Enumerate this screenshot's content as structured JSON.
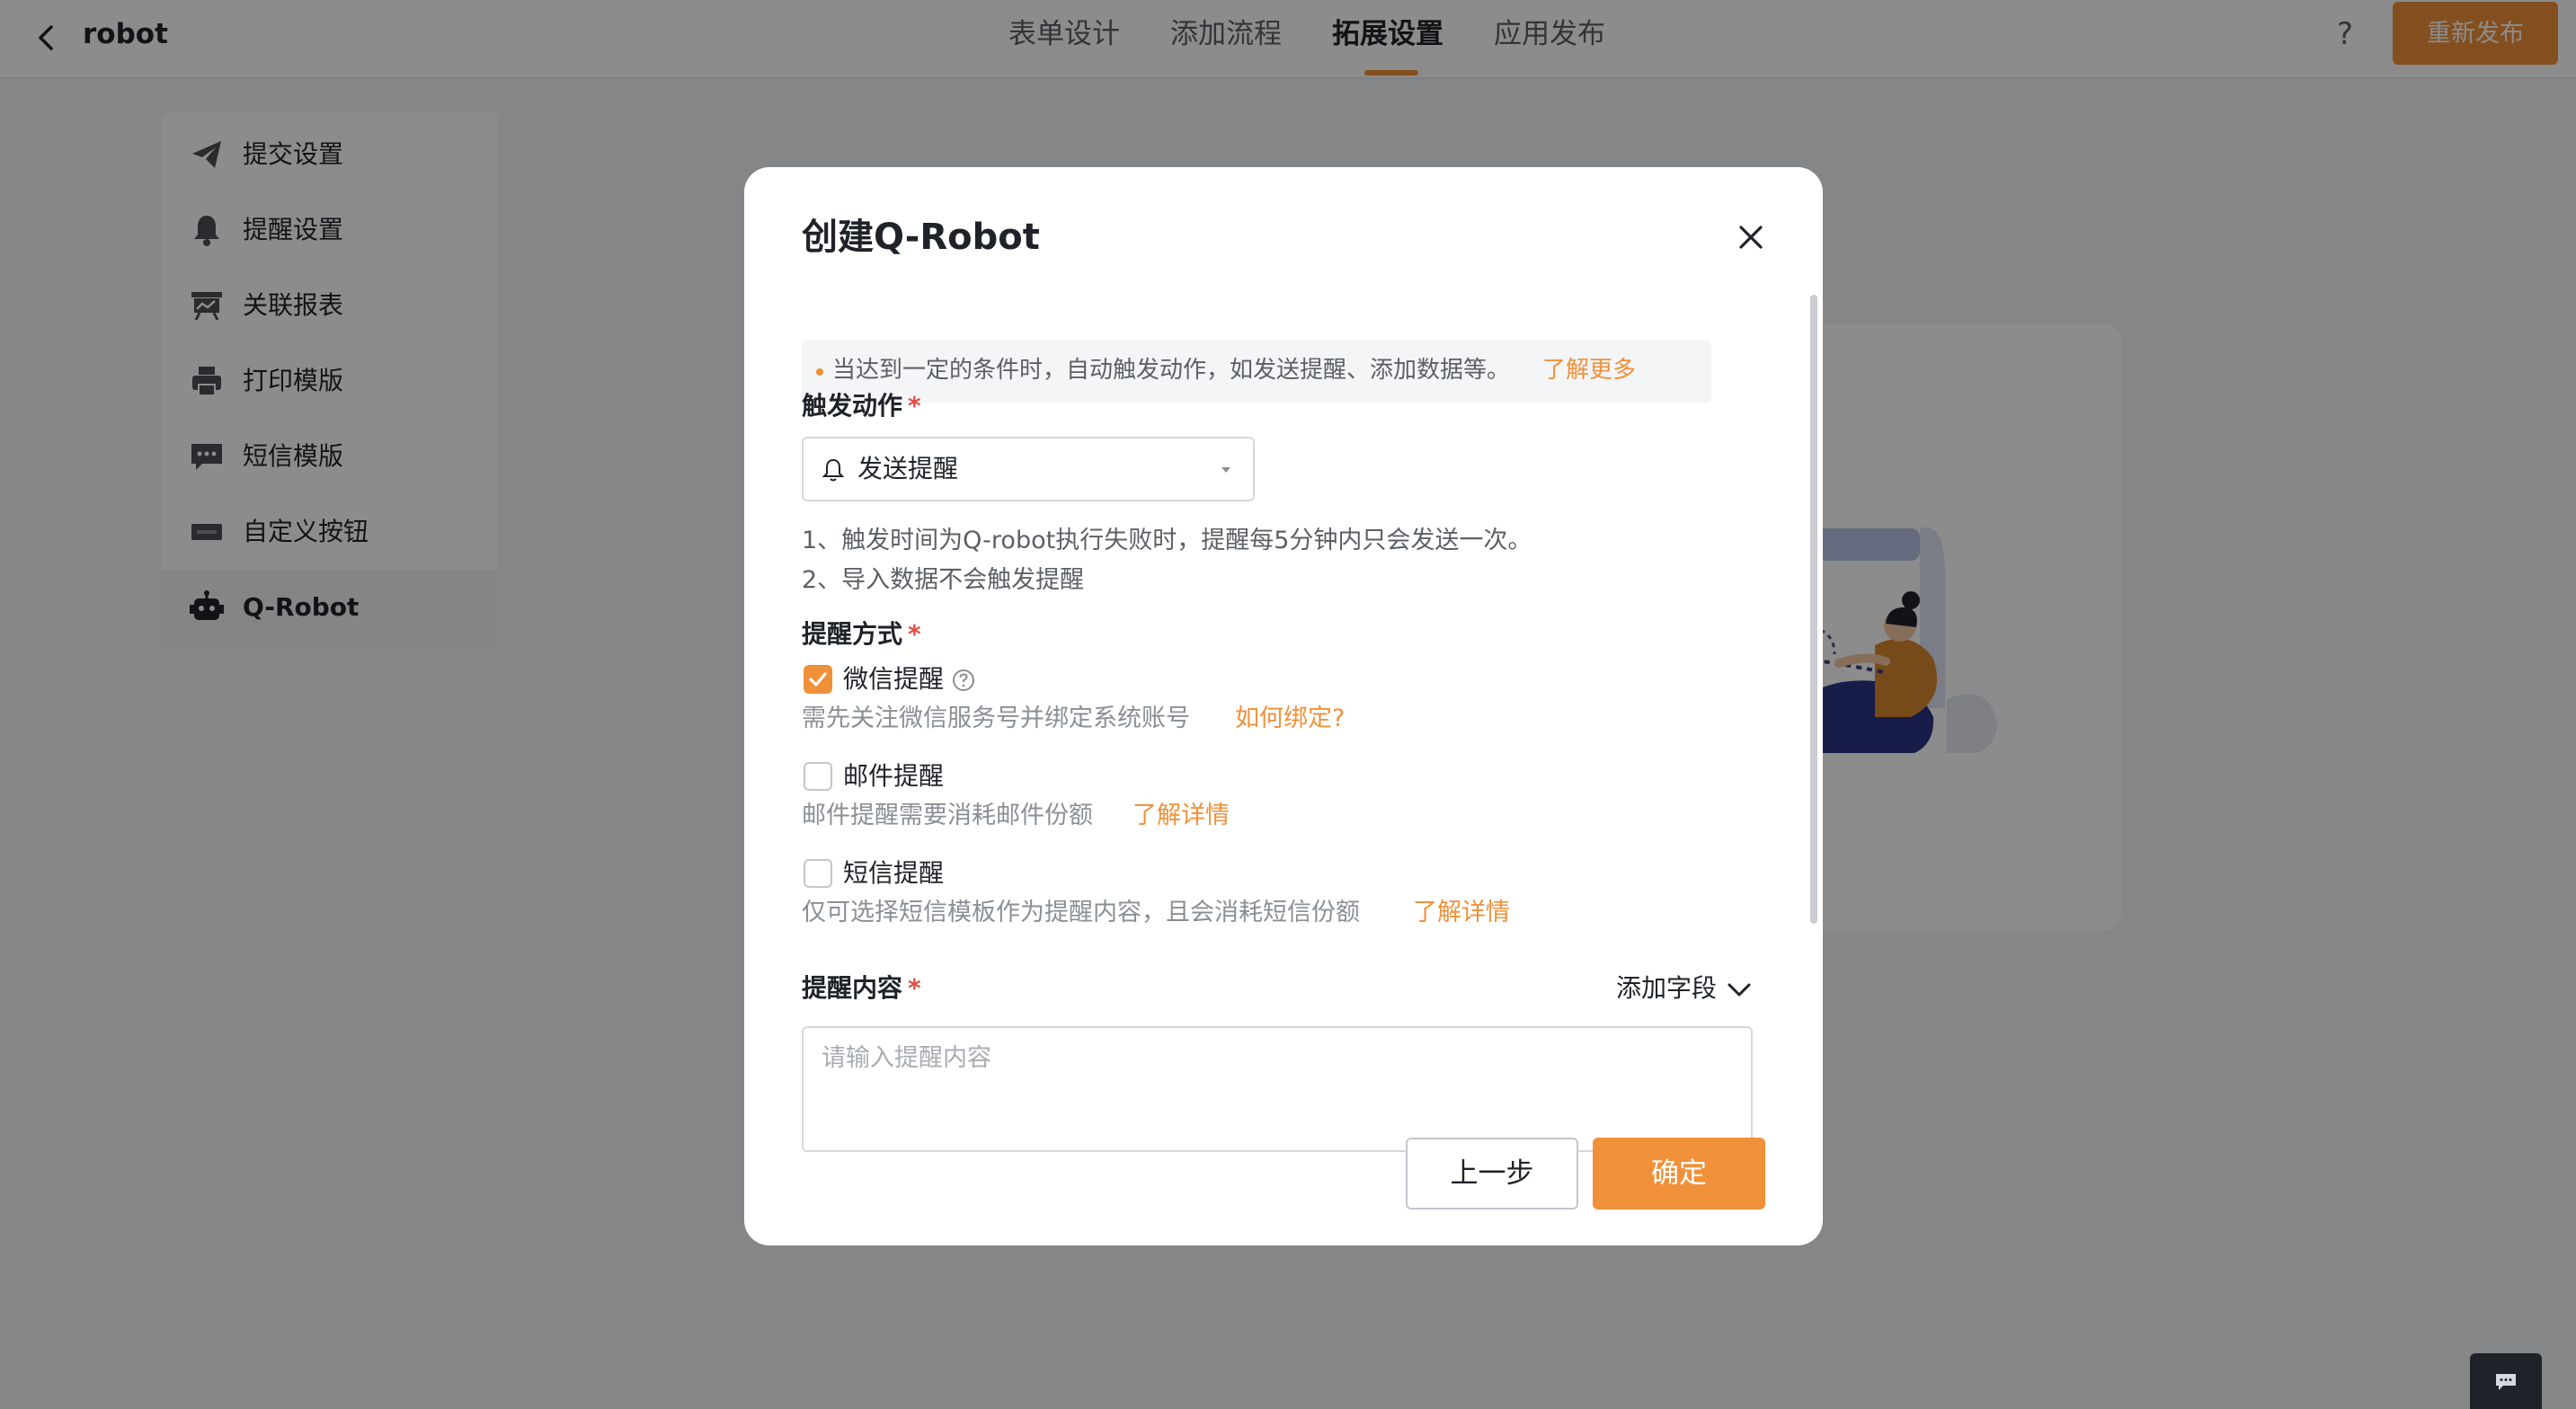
{
  "header": {
    "title": "robot",
    "tabs": [
      {
        "label": "表单设计"
      },
      {
        "label": "添加流程"
      },
      {
        "label": "拓展设置"
      },
      {
        "label": "应用发布"
      }
    ],
    "help_label": "?",
    "republish_label": "重新发布",
    "accent_color": "#f0913a"
  },
  "side_menu": {
    "items": [
      {
        "label": "提交设置",
        "icon": "paper-plane-icon"
      },
      {
        "label": "提醒设置",
        "icon": "bell-icon"
      },
      {
        "label": "关联报表",
        "icon": "report-board-icon"
      },
      {
        "label": "打印模版",
        "icon": "printer-icon"
      },
      {
        "label": "短信模版",
        "icon": "message-icon"
      },
      {
        "label": "自定义按钮",
        "icon": "custom-button-icon"
      },
      {
        "label": "Q-Robot",
        "icon": "robot-icon",
        "active": true
      }
    ]
  },
  "modal": {
    "title": "创建Q-Robot",
    "info_text": "当达到一定的条件时，自动触发动作，如发送提醒、添加数据等。",
    "info_link": "了解更多",
    "trigger": {
      "label": "触发动作",
      "required_mark": "*",
      "value": "发送提醒",
      "notes": [
        "1、触发时间为Q-robot执行失败时，提醒每5分钟内只会发送一次。",
        "2、导入数据不会触发提醒"
      ]
    },
    "reminder_method": {
      "label": "提醒方式",
      "required_mark": "*",
      "options": [
        {
          "label": "微信提醒",
          "checked": true,
          "hint": "需先关注微信服务号并绑定系统账号",
          "link": "如何绑定?"
        },
        {
          "label": "邮件提醒",
          "checked": false,
          "hint": "邮件提醒需要消耗邮件份额",
          "link": "了解详情"
        },
        {
          "label": "短信提醒",
          "checked": false,
          "hint": "仅可选择短信模板作为提醒内容，且会消耗短信份额",
          "link": "了解详情"
        }
      ]
    },
    "content": {
      "label": "提醒内容",
      "required_mark": "*",
      "add_field": "添加字段",
      "placeholder": "请输入提醒内容"
    },
    "buttons": {
      "prev": "上一步",
      "ok": "确定"
    }
  }
}
